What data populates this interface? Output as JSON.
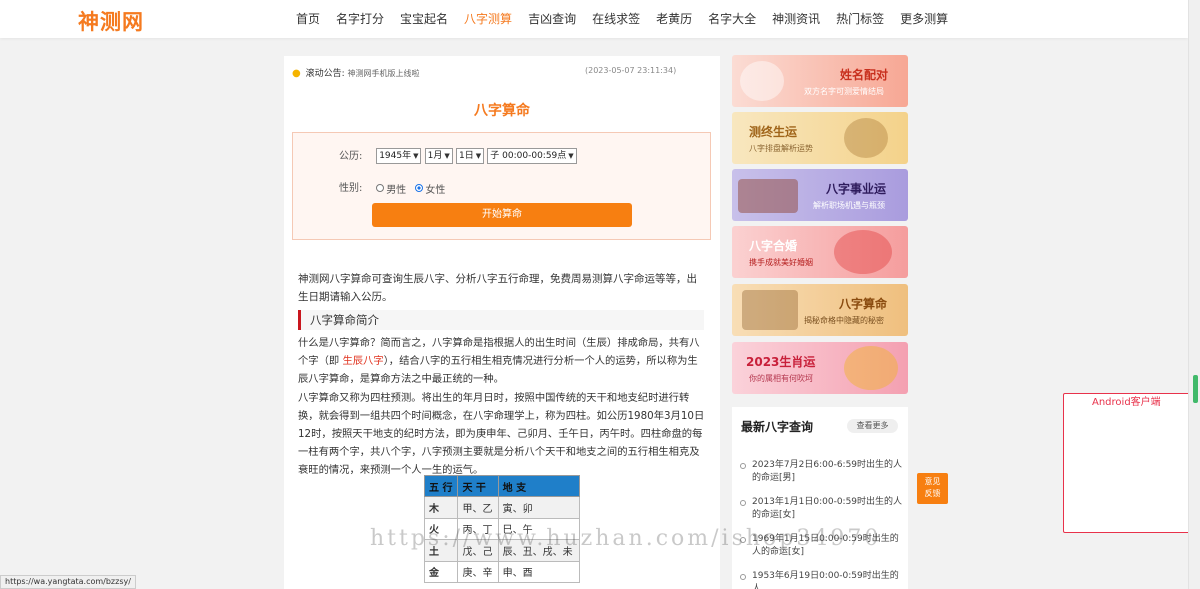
{
  "header": {
    "logo": "神测网",
    "nav": [
      "首页",
      "名字打分",
      "宝宝起名",
      "八字测算",
      "吉凶查询",
      "在线求签",
      "老黄历",
      "名字大全",
      "神测资讯",
      "热门标签",
      "更多测算"
    ],
    "active_index": 3
  },
  "notice": {
    "label": "滚动公告:",
    "text": "神测网手机版上线啦",
    "time": "(2023-05-07 23:11:34)"
  },
  "form": {
    "title": "八字算命",
    "date_label": "公历:",
    "year": "1945年",
    "month": "1月",
    "day": "1日",
    "hour": "子 00:00-00:59点",
    "gender_label": "性别:",
    "gender_male": "男性",
    "gender_female": "女性",
    "selected_gender": "女性",
    "submit": "开始算命"
  },
  "article": {
    "intro": "神测网八字算命可查询生辰八字、分析八字五行命理，免费周易测算八字命运等等，出生日期请输入公历。",
    "section_title": "八字算命简介",
    "p1_a": "什么是八字算命？简而言之，八字算命是指根据人的出生时间（生辰）排成命局，共有八个字（即 ",
    "p1_link": "生辰八字",
    "p1_b": "），结合八字的五行相生相克情况进行分析一个人的运势，所以称为生辰八字算命，是算命方法之中最正统的一种。",
    "p2": "八字算命又称为四柱预测。将出生的年月日时，按照中国传统的天干和地支纪时进行转换，就会得到一组共四个时间概念，在八字命理学上，称为四柱。如公历1980年3月10日12时，按照天干地支的纪时方法，即为庚申年、己卯月、壬午日，丙午时。四柱命盘的每一柱有两个字，共八个字，八字预测主要就是分析八个天干和地支之间的五行相生相克及衰旺的情况，来预测一个人一生的运气。"
  },
  "table": {
    "headers": [
      "五 行",
      "天 干",
      "地 支"
    ],
    "rows": [
      [
        "木",
        "甲、乙",
        "寅、卯"
      ],
      [
        "火",
        "丙、丁",
        "巳、午"
      ],
      [
        "土",
        "戊、己",
        "辰、丑、戌、未"
      ],
      [
        "金",
        "庚、辛",
        "申、酉"
      ]
    ],
    "header_color": "#1f7fc9"
  },
  "sidebar": {
    "banners": [
      {
        "title": "姓名配对",
        "sub": "双方名字可测爱情结局"
      },
      {
        "title": "测终生运",
        "sub": "八字排盘解析运势"
      },
      {
        "title": "八字事业运",
        "sub": "解析职场机遇与瓶颈"
      },
      {
        "title": "八字合婚",
        "sub": "携手成就美好婚姻"
      },
      {
        "title": "八字算命",
        "sub": "揭秘命格中隐藏的秘密"
      },
      {
        "title": "2023生肖运",
        "sub": "你的属相有何吹坷"
      }
    ],
    "latest_title": "最新八字查询",
    "more": "查看更多",
    "latest": [
      "2023年7月2日6:00-6:59时出生的人的命运[男]",
      "2013年1月1日0:00-0:59时出生的人的命运[女]",
      "1969年1月15日0:00-0:59时出生的人的命运[女]",
      "1953年6月19日0:00-0:59时出生的人"
    ]
  },
  "floating": {
    "android": "Android客户端",
    "feedback_1": "意见",
    "feedback_2": "反馈"
  },
  "status_url": "https://wa.yangtata.com/bzzsy/",
  "watermark": "https://www.huzhan.com/ishop34970",
  "colors": {
    "accent": "#f57a1f",
    "button": "#f77f11",
    "section_bar": "#c9171e",
    "android_border": "#e8324b"
  }
}
